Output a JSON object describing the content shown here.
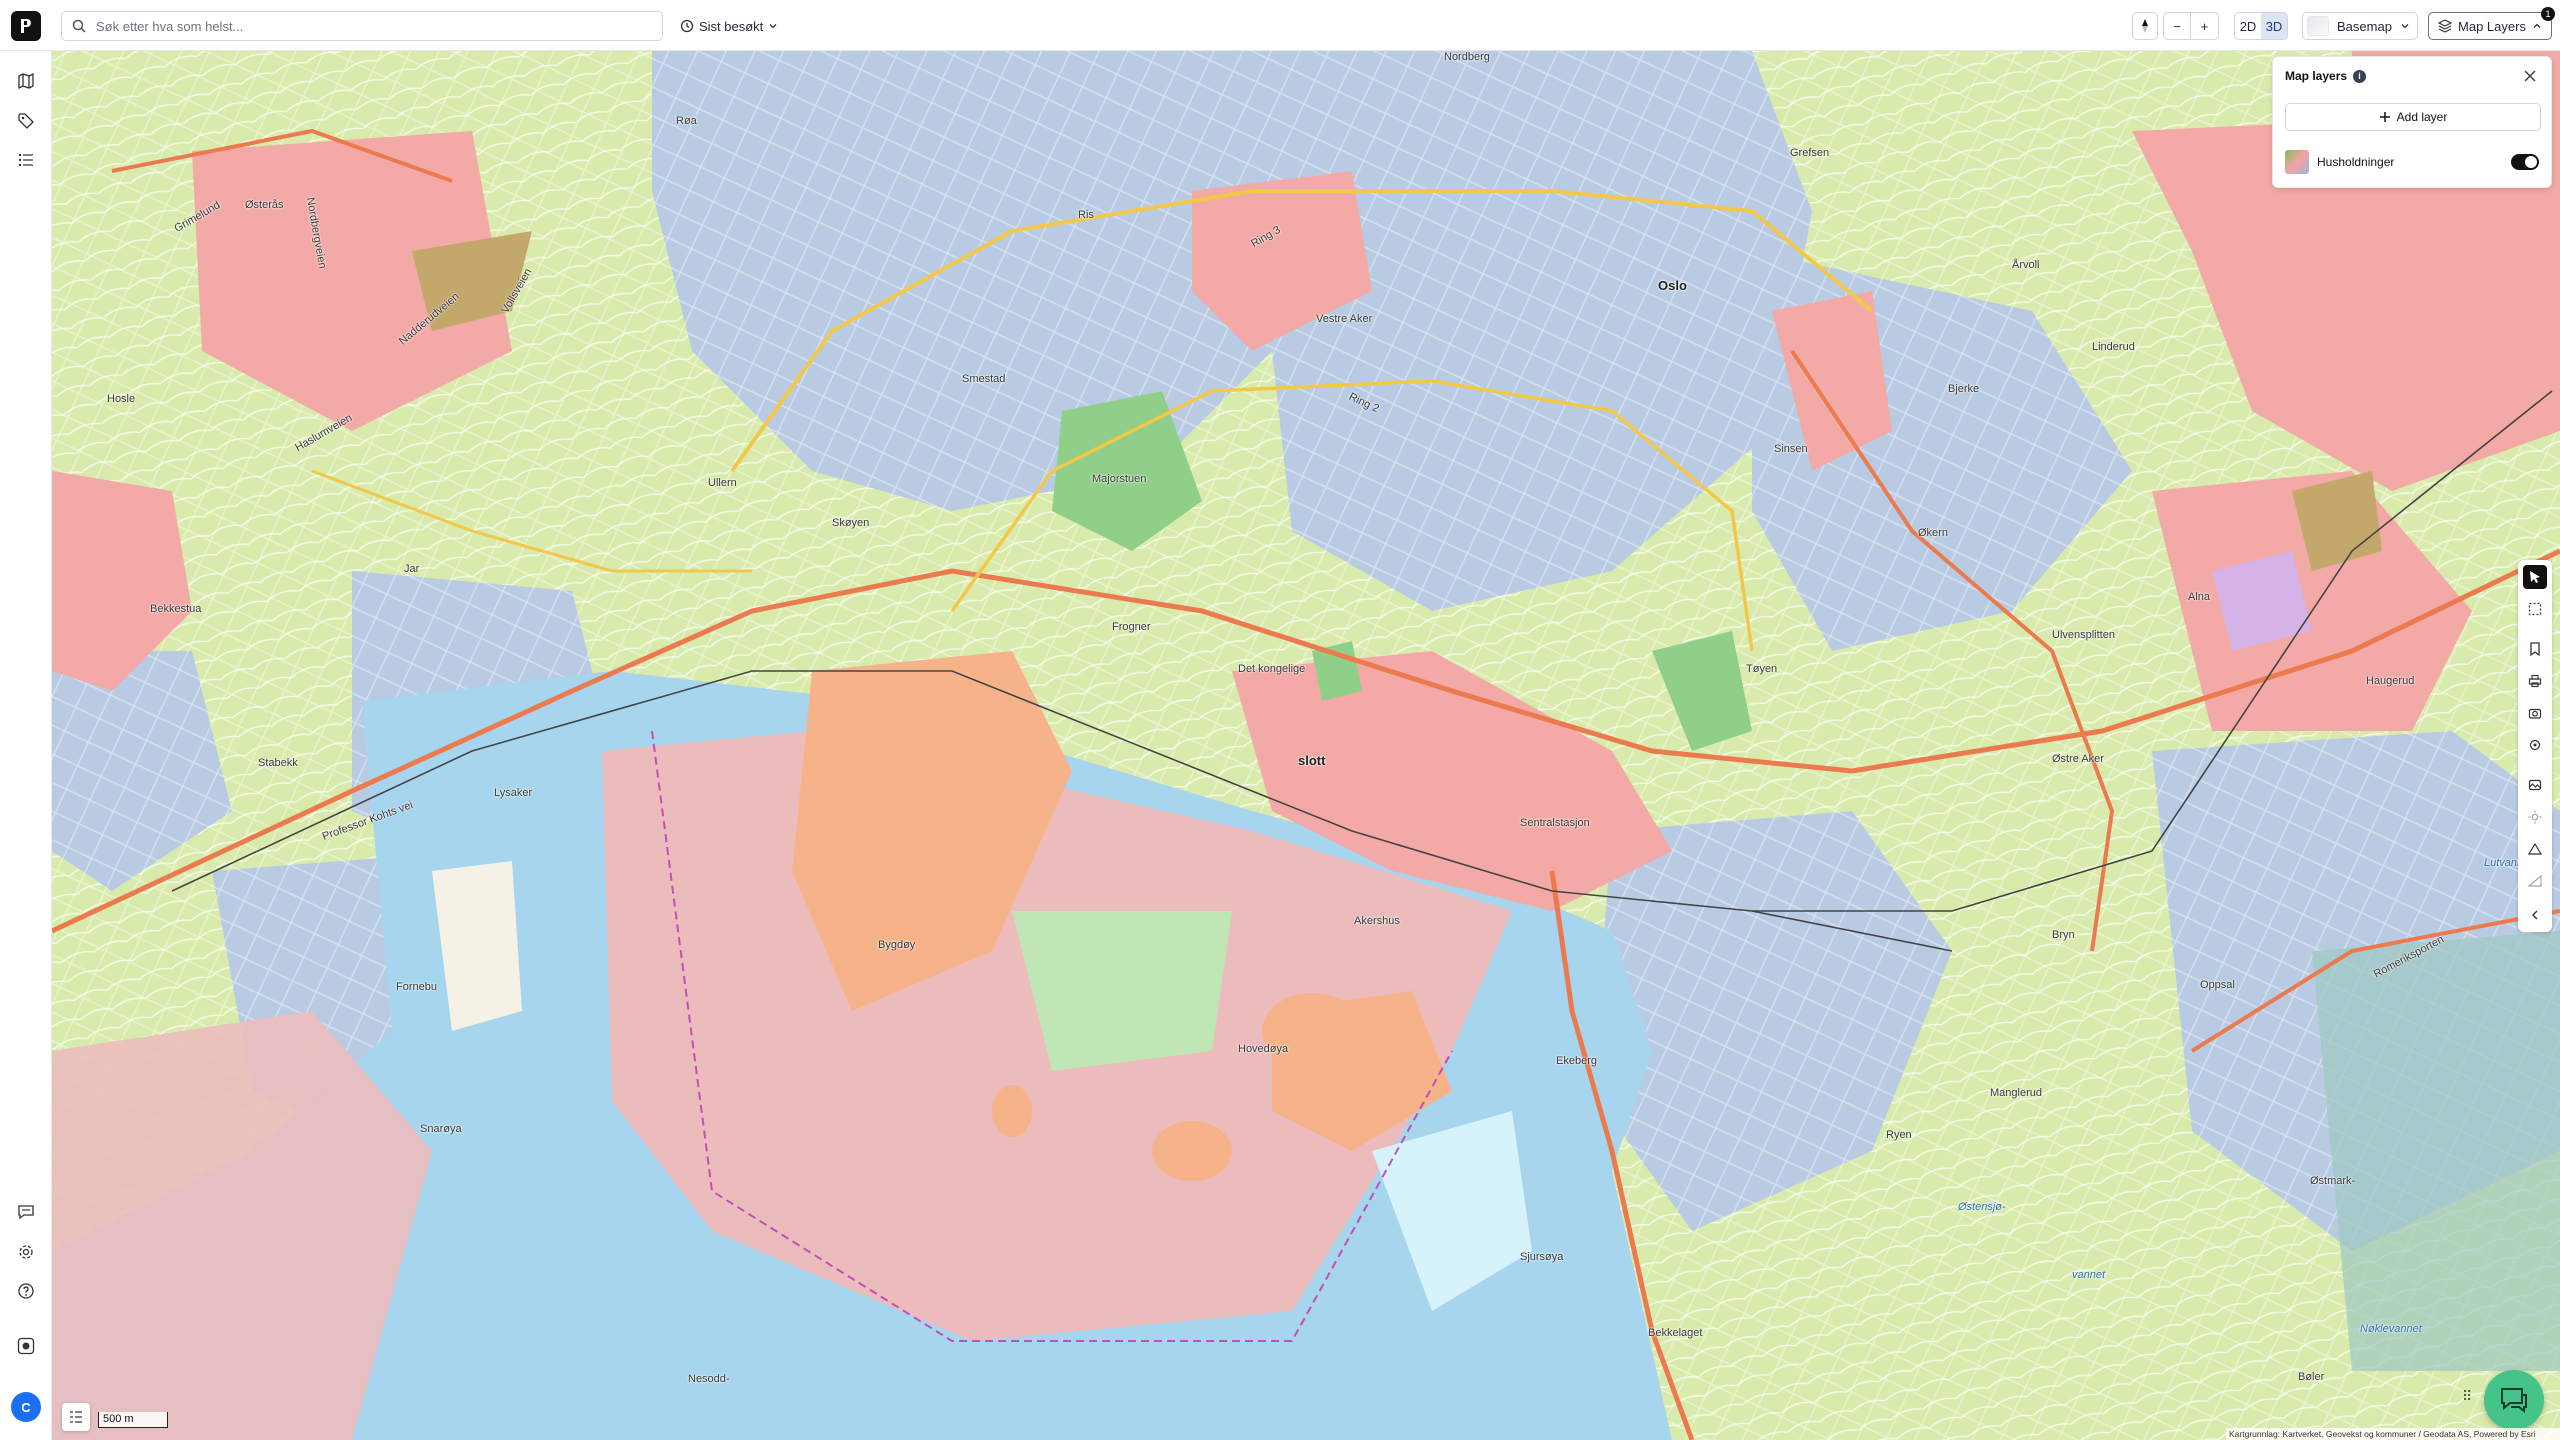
{
  "topbar": {
    "search_placeholder": "Søk etter hva som helst...",
    "recent_label": "Sist besøkt",
    "view_2d": "2D",
    "view_3d": "3D",
    "basemap_label": "Basemap",
    "map_layers_label": "Map Layers",
    "map_layers_badge": "1",
    "zoom_out": "−",
    "zoom_in": "+"
  },
  "sidebar": {
    "avatar_initial": "C"
  },
  "layers_panel": {
    "title": "Map layers",
    "info": "i",
    "add_layer": "Add layer",
    "layers": [
      {
        "name": "Husholdninger",
        "visible": true
      }
    ]
  },
  "map": {
    "scale_label": "500 m",
    "attribution": "Kartgrunnlag: Kartverket, Geovekst og kommuner / Geodata AS, Powered by Esri",
    "places": [
      {
        "name": "Nordberg"
      },
      {
        "name": "Røa"
      },
      {
        "name": "Østerås"
      },
      {
        "name": "Grimelund"
      },
      {
        "name": "Nordbergveien"
      },
      {
        "name": "Nadderudveien"
      },
      {
        "name": "Vollsveien"
      },
      {
        "name": "Hosle"
      },
      {
        "name": "Haslumveien"
      },
      {
        "name": "Ris"
      },
      {
        "name": "Vestre Aker"
      },
      {
        "name": "Oslo"
      },
      {
        "name": "Grefsen"
      },
      {
        "name": "Årvoll"
      },
      {
        "name": "Linderud"
      },
      {
        "name": "Bjerke"
      },
      {
        "name": "Sinsen"
      },
      {
        "name": "Smestad"
      },
      {
        "name": "Ring 3"
      },
      {
        "name": "Ring 2"
      },
      {
        "name": "Majorstuen"
      },
      {
        "name": "Ullern"
      },
      {
        "name": "Skøyen"
      },
      {
        "name": "Jar"
      },
      {
        "name": "Bekkestua"
      },
      {
        "name": "Frogner"
      },
      {
        "name": "Det kongelige"
      },
      {
        "name": "slott"
      },
      {
        "name": "Økern"
      },
      {
        "name": "Alna"
      },
      {
        "name": "Ulvensplitten"
      },
      {
        "name": "Haugerud"
      },
      {
        "name": "Tøyen"
      },
      {
        "name": "Østre Aker"
      },
      {
        "name": "Stabekk"
      },
      {
        "name": "Lysaker"
      },
      {
        "name": "Professor Kohts vei"
      },
      {
        "name": "Sentralstasjon"
      },
      {
        "name": "Akershus"
      },
      {
        "name": "Bygdøy"
      },
      {
        "name": "Fornebu"
      },
      {
        "name": "Hovedøya"
      },
      {
        "name": "Ekeberg"
      },
      {
        "name": "Manglerud"
      },
      {
        "name": "Bryn"
      },
      {
        "name": "Oppsal"
      },
      {
        "name": "Ryen"
      },
      {
        "name": "Østensjø-"
      },
      {
        "name": "vannet"
      },
      {
        "name": "Østmark-"
      },
      {
        "name": "Snarøya"
      },
      {
        "name": "Sjursøya"
      },
      {
        "name": "Bekkelaget"
      },
      {
        "name": "Nesodd-"
      },
      {
        "name": "Nøklevannet"
      },
      {
        "name": "Romeriksporten"
      },
      {
        "name": "Lutvann"
      },
      {
        "name": "Bøler"
      }
    ]
  },
  "colors": {
    "residential": "#b9cbe3",
    "green": "#d9ebac",
    "park": "#8fcf8a",
    "commercial": "#f3a9a5",
    "industry": "#f6b38a",
    "water": "#a7d5ee",
    "sea_zone": "#ecbcbc",
    "road_main": "#ec7a4f",
    "road_secondary": "#f2c84b",
    "accent_chat": "#46c389"
  }
}
